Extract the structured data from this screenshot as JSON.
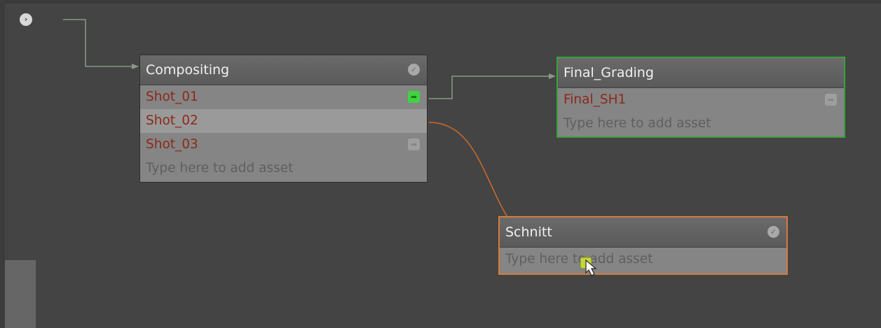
{
  "canvas": {
    "start_glyph": "›"
  },
  "nodes": {
    "compositing": {
      "title": "Compositing",
      "assets": [
        {
          "label": "Shot_01",
          "share_state": "active"
        },
        {
          "label": "Shot_02",
          "share_state": "none"
        },
        {
          "label": "Shot_03",
          "share_state": "inactive"
        }
      ],
      "add_placeholder": "Type here to add asset",
      "border_color": "#2f2f2f"
    },
    "final_grading": {
      "title": "Final_Grading",
      "assets": [
        {
          "label": "Final_SH1",
          "share_state": "inactive"
        }
      ],
      "add_placeholder": "Type here to add asset",
      "border_color": "#3aa33a"
    },
    "schnitt": {
      "title": "Schnitt",
      "assets": [],
      "add_placeholder": "Type here to add asset",
      "border_color": "#d97a3a"
    }
  },
  "colors": {
    "background": "#444444",
    "asset_text": "#8b2a1a",
    "placeholder_text": "#5f5f5f",
    "wire": "#8a9a8a",
    "drag_wire": "#d06a2a",
    "share_active": "#3ed43e"
  },
  "icons": {
    "start": "play-circle-icon",
    "node_status": "check-circle-icon",
    "asset_share": "share-arrow-icon",
    "cursor": "hand-pointer-icon"
  }
}
